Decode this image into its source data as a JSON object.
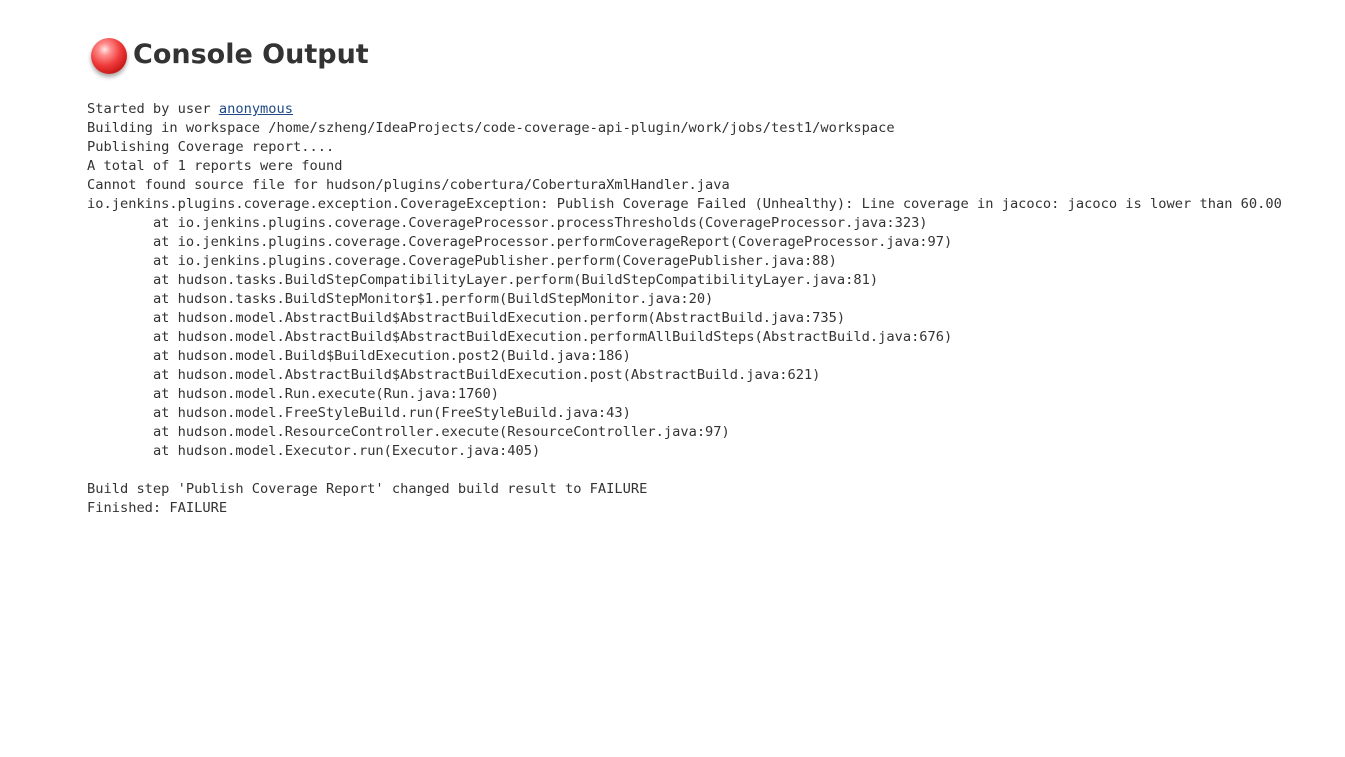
{
  "page": {
    "title": "Console Output",
    "status_icon": "red-ball-failure-icon",
    "status_color": "#e02828"
  },
  "console": {
    "started_prefix": "Started by user ",
    "started_user": "anonymous",
    "lines": [
      "Building in workspace /home/szheng/IdeaProjects/code-coverage-api-plugin/work/jobs/test1/workspace",
      "Publishing Coverage report....",
      "A total of 1 reports were found",
      "Cannot found source file for hudson/plugins/cobertura/CoberturaXmlHandler.java",
      "io.jenkins.plugins.coverage.exception.CoverageException: Publish Coverage Failed (Unhealthy): Line coverage in jacoco: jacoco is lower than 60.00",
      "\tat io.jenkins.plugins.coverage.CoverageProcessor.processThresholds(CoverageProcessor.java:323)",
      "\tat io.jenkins.plugins.coverage.CoverageProcessor.performCoverageReport(CoverageProcessor.java:97)",
      "\tat io.jenkins.plugins.coverage.CoveragePublisher.perform(CoveragePublisher.java:88)",
      "\tat hudson.tasks.BuildStepCompatibilityLayer.perform(BuildStepCompatibilityLayer.java:81)",
      "\tat hudson.tasks.BuildStepMonitor$1.perform(BuildStepMonitor.java:20)",
      "\tat hudson.model.AbstractBuild$AbstractBuildExecution.perform(AbstractBuild.java:735)",
      "\tat hudson.model.AbstractBuild$AbstractBuildExecution.performAllBuildSteps(AbstractBuild.java:676)",
      "\tat hudson.model.Build$BuildExecution.post2(Build.java:186)",
      "\tat hudson.model.AbstractBuild$AbstractBuildExecution.post(AbstractBuild.java:621)",
      "\tat hudson.model.Run.execute(Run.java:1760)",
      "\tat hudson.model.FreeStyleBuild.run(FreeStyleBuild.java:43)",
      "\tat hudson.model.ResourceController.execute(ResourceController.java:97)",
      "\tat hudson.model.Executor.run(Executor.java:405)",
      "",
      "Build step 'Publish Coverage Report' changed build result to FAILURE",
      "Finished: FAILURE"
    ]
  }
}
